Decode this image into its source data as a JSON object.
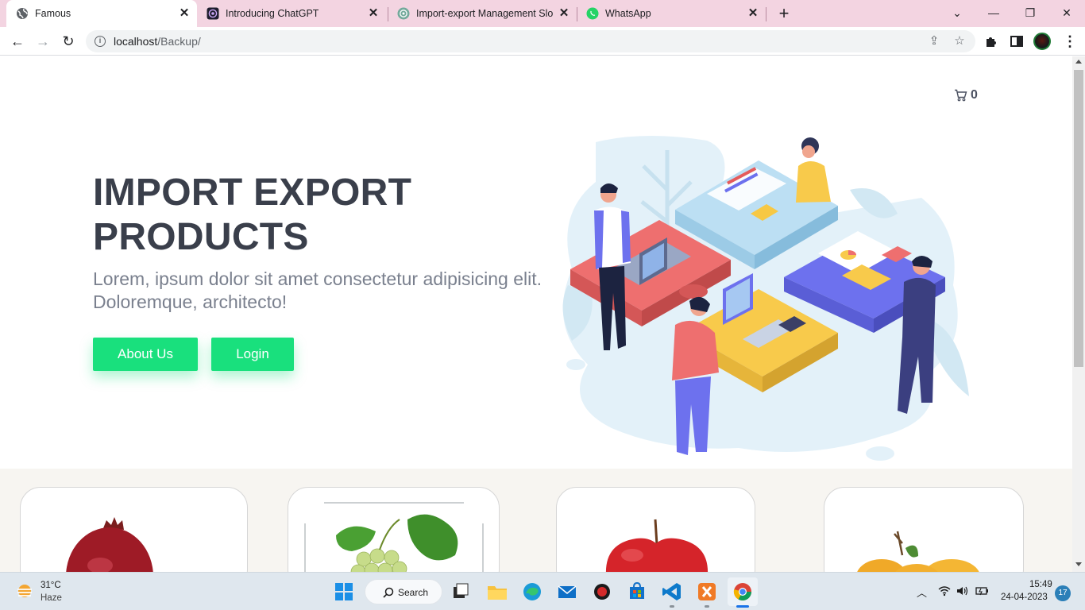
{
  "browser": {
    "tabs": [
      {
        "title": "Famous",
        "active": true
      },
      {
        "title": "Introducing ChatGPT",
        "active": false
      },
      {
        "title": "Import-export Management Slog",
        "active": false
      },
      {
        "title": "WhatsApp",
        "active": false
      }
    ],
    "address": {
      "host": "localhost",
      "path": "/Backup/"
    }
  },
  "page": {
    "cart_count": "0",
    "hero": {
      "title": "IMPORT EXPORT PRODUCTS",
      "subtitle": "Lorem, ipsum dolor sit amet consectetur adipisicing elit. Doloremque, architecto!",
      "buttons": {
        "about": "About Us",
        "login": "Login"
      }
    },
    "products": [
      "pomegranate",
      "grapes",
      "apple",
      "orange"
    ]
  },
  "taskbar": {
    "weather": {
      "temp": "31°C",
      "desc": "Haze"
    },
    "search_label": "Search",
    "time": "15:49",
    "date": "24-04-2023",
    "notifications": "17"
  },
  "colors": {
    "tabstrip": "#f3d4e1",
    "accent_green": "#19e07d",
    "heading": "#3a3f4b",
    "subtext": "#7a808e"
  }
}
